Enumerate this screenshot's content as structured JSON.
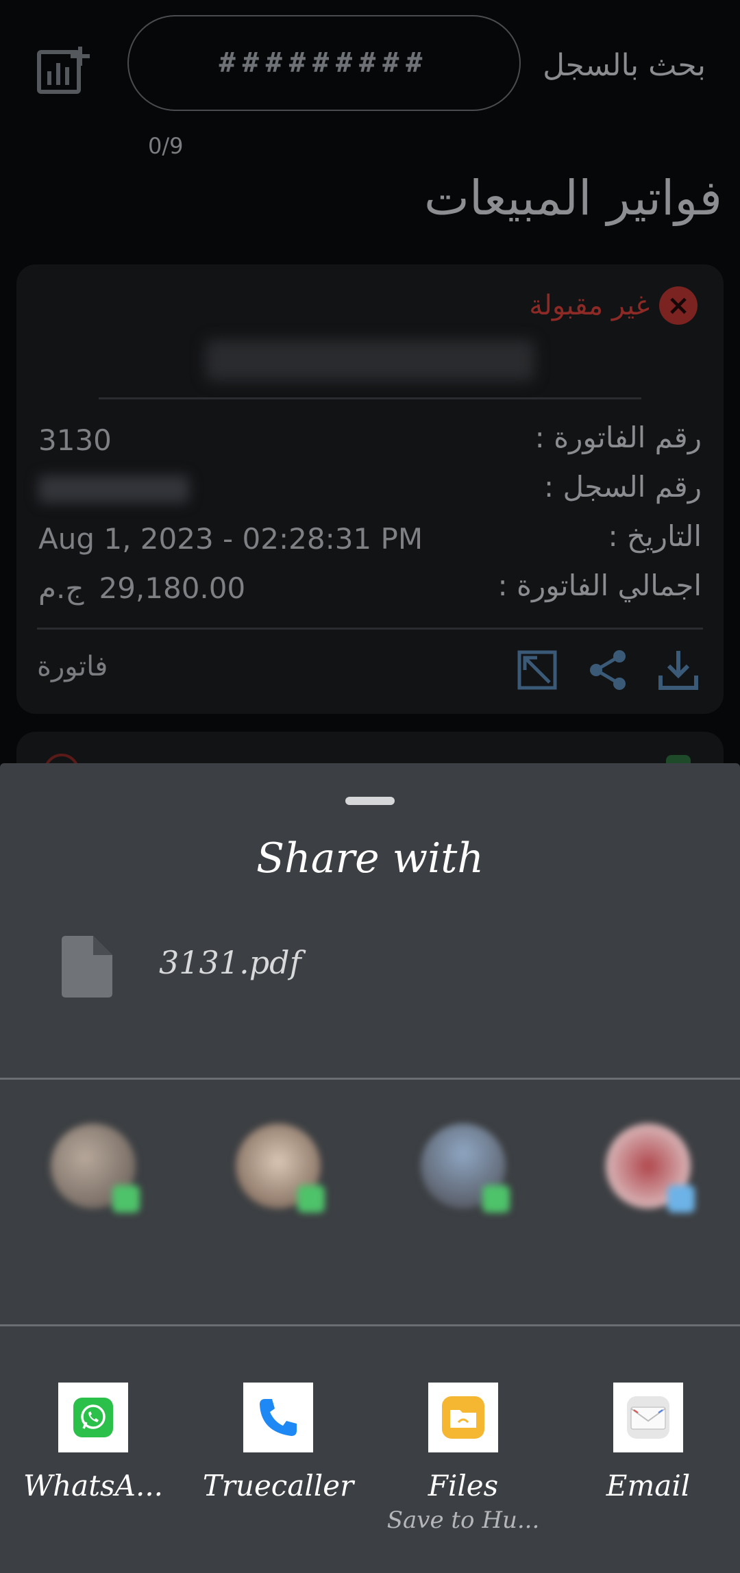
{
  "header": {
    "search_value": "#########",
    "search_label": "بحث بالسجل",
    "counter": "0/9",
    "page_title": "فواتير المبيعات"
  },
  "invoice_card": {
    "status": "غير مقبولة",
    "rows": [
      {
        "label": "رقم الفاتورة :",
        "value": "3130"
      },
      {
        "label": "رقم السجل :",
        "value": ""
      },
      {
        "label": "التاريخ :",
        "value": "Aug 1, 2023 - 02:28:31 PM"
      },
      {
        "label": "اجمالي الفاتورة :",
        "value": "29,180.00",
        "currency": "ج.م"
      }
    ],
    "type_label": "فاتورة"
  },
  "share_sheet": {
    "title": "Share with",
    "file_name": "3131.pdf",
    "apps": [
      {
        "label": "WhatsA...",
        "icon": "whatsapp-icon",
        "color": "#2ac04a"
      },
      {
        "label": "Truecaller",
        "icon": "phone-icon",
        "color": "#1e88f5"
      },
      {
        "label": "Files",
        "sublabel": "Save to Hu...",
        "icon": "files-icon",
        "color": "#f5b632"
      },
      {
        "label": "Email",
        "icon": "email-icon",
        "color": "#d9d9d9"
      }
    ]
  },
  "colors": {
    "sheet_bg": "#3c3f43",
    "status_red": "#8d2a26",
    "accent_icon": "#3a5a78"
  }
}
